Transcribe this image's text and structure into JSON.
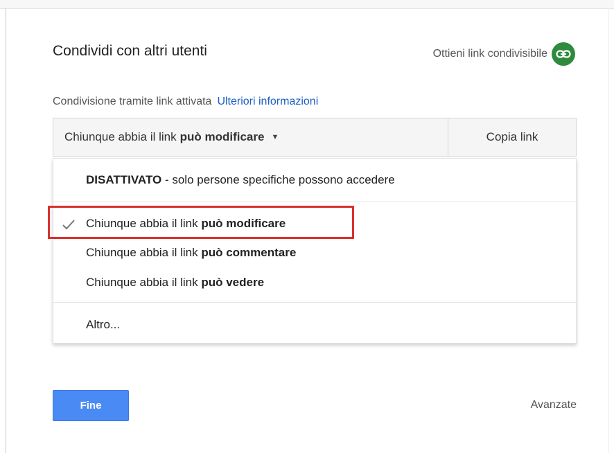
{
  "dialog": {
    "title": "Condividi con altri utenti",
    "get_shareable_link": "Ottieni link condivisibile"
  },
  "status": {
    "text": "Condivisione tramite link attivata",
    "more_info": "Ulteriori informazioni"
  },
  "access": {
    "prefix": "Chiunque abbia il link",
    "selected_permission": "può modificare",
    "copy_link": "Copia link"
  },
  "menu": {
    "off_option": {
      "bold": "DISATTIVATO",
      "rest": " - solo persone specifiche possono accedere"
    },
    "options": [
      {
        "prefix": "Chiunque abbia il link",
        "permission": "può modificare",
        "checked": true
      },
      {
        "prefix": "Chiunque abbia il link",
        "permission": "può commentare",
        "checked": false
      },
      {
        "prefix": "Chiunque abbia il link",
        "permission": "può vedere",
        "checked": false
      }
    ],
    "more": "Altro..."
  },
  "footer": {
    "done": "Fine",
    "advanced": "Avanzate"
  },
  "colors": {
    "accent_blue": "#4a8af4",
    "link_blue": "#1a5fc5",
    "link_icon_green": "#2e8b3d",
    "highlight_red": "#d9302e"
  }
}
